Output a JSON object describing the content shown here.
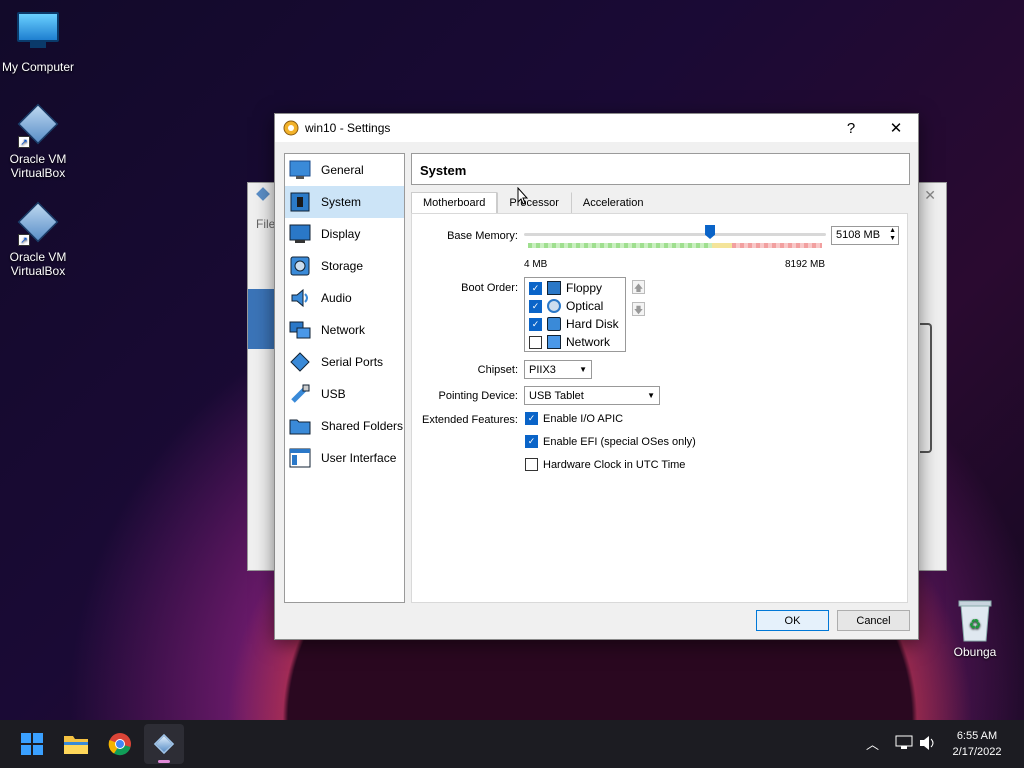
{
  "desktop": {
    "icons": [
      {
        "label": "My Computer",
        "icon": "computer-icon"
      },
      {
        "label": "Oracle VM VirtualBox",
        "icon": "virtualbox-icon"
      },
      {
        "label": "Oracle VM VirtualBox",
        "icon": "virtualbox-icon"
      },
      {
        "label": "Obunga",
        "icon": "recycle-bin-icon"
      }
    ]
  },
  "background_window": {
    "menu_fragment": "File"
  },
  "dialog": {
    "title": "win10 - Settings",
    "help": "?",
    "close": "✕",
    "sidebar": [
      {
        "label": "General",
        "icon": "general-icon"
      },
      {
        "label": "System",
        "icon": "system-icon",
        "selected": true
      },
      {
        "label": "Display",
        "icon": "display-icon"
      },
      {
        "label": "Storage",
        "icon": "storage-icon"
      },
      {
        "label": "Audio",
        "icon": "audio-icon"
      },
      {
        "label": "Network",
        "icon": "network-icon"
      },
      {
        "label": "Serial Ports",
        "icon": "serial-ports-icon"
      },
      {
        "label": "USB",
        "icon": "usb-icon"
      },
      {
        "label": "Shared Folders",
        "icon": "shared-folders-icon"
      },
      {
        "label": "User Interface",
        "icon": "user-interface-icon"
      }
    ],
    "section_title": "System",
    "tabs": [
      {
        "label": "Motherboard",
        "active": true
      },
      {
        "label": "Processor"
      },
      {
        "label": "Acceleration"
      }
    ],
    "motherboard": {
      "base_memory_label": "Base Memory:",
      "base_memory_value": "5108 MB",
      "base_memory_fraction": 0.62,
      "min_label": "4 MB",
      "max_label": "8192 MB",
      "boot_order_label": "Boot Order:",
      "boot_order": [
        {
          "label": "Floppy",
          "checked": true,
          "icon": "floppy-icon"
        },
        {
          "label": "Optical",
          "checked": true,
          "icon": "optical-icon"
        },
        {
          "label": "Hard Disk",
          "checked": true,
          "icon": "hard-disk-icon"
        },
        {
          "label": "Network",
          "checked": false,
          "icon": "network-icon"
        }
      ],
      "chipset_label": "Chipset:",
      "chipset_value": "PIIX3",
      "pointing_label": "Pointing Device:",
      "pointing_value": "USB Tablet",
      "extended_label": "Extended Features:",
      "features": [
        {
          "label": "Enable I/O APIC",
          "checked": true
        },
        {
          "label": "Enable EFI (special OSes only)",
          "checked": true
        },
        {
          "label": "Hardware Clock in UTC Time",
          "checked": false
        }
      ]
    },
    "ok": "OK",
    "cancel": "Cancel"
  },
  "taskbar": {
    "apps": [
      "start-icon",
      "file-explorer-icon",
      "chrome-icon",
      "virtualbox-icon"
    ],
    "time": "6:55 AM",
    "date": "2/17/2022"
  },
  "colors": {
    "accent": "#0a64c8",
    "selection": "#cce4f7"
  }
}
